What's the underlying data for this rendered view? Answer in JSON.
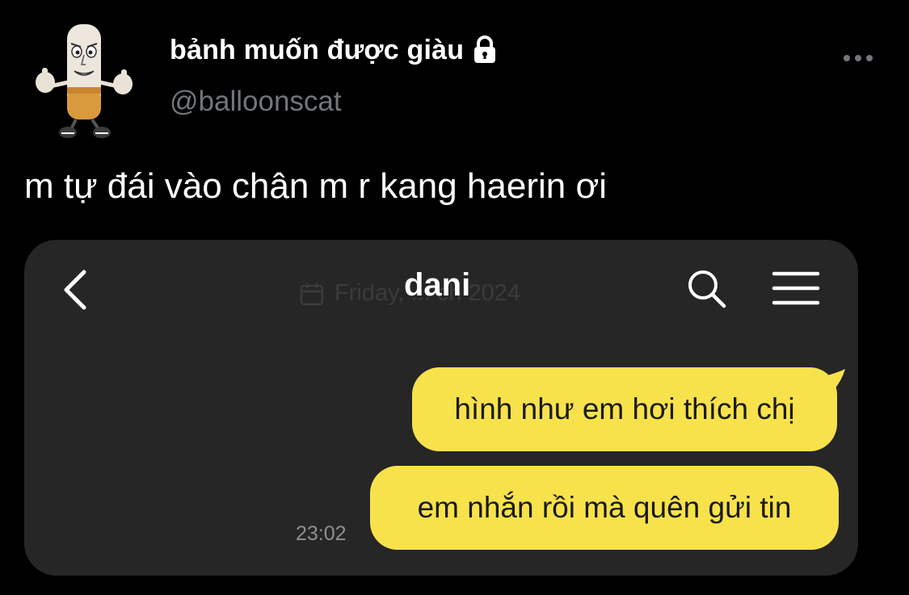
{
  "tweet": {
    "author": {
      "display_name": "bảnh muốn được giàu",
      "handle": "@balloonscat",
      "avatar": "cartoon-character-avatar",
      "lock_icon": "lock-icon"
    },
    "more_icon": "more-options-icon",
    "text": "m tự đái vào chân m r kang haerin ơi"
  },
  "chat": {
    "title": "dani",
    "date_ghost": "Friday, ... ch 2024",
    "back_icon": "chevron-left-icon",
    "search_icon": "search-icon",
    "menu_icon": "hamburger-menu-icon",
    "messages": [
      {
        "text": "hình như em hơi thích chị"
      },
      {
        "text": "em nhắn rồi mà quên gửi tin"
      }
    ],
    "timestamp": "23:02",
    "bubble_color": "#f8e24b",
    "background_color": "#262627"
  }
}
